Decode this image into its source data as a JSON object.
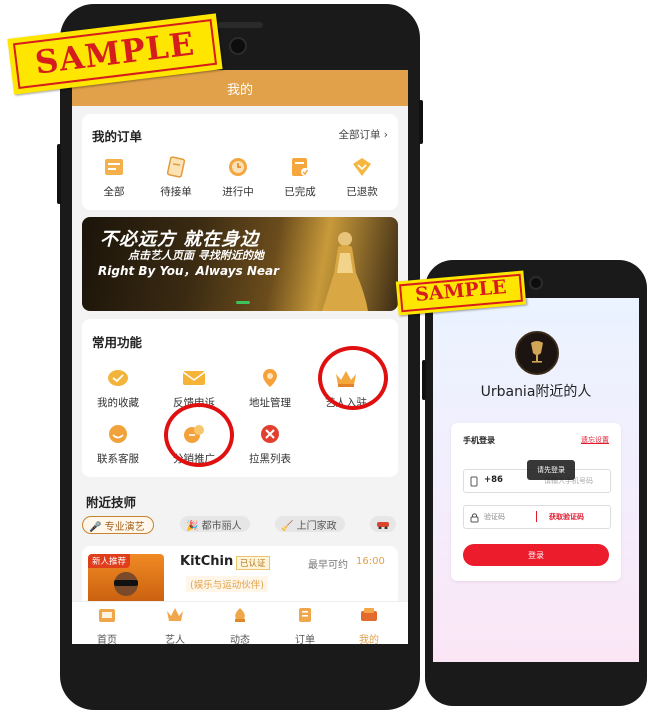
{
  "stamps": {
    "label": "SAMPLE"
  },
  "app": {
    "header_title": "我的",
    "orders": {
      "title": "我的订单",
      "all_link": "全部订单 ›",
      "items": [
        {
          "label": "全部",
          "icon": "all-orders-icon"
        },
        {
          "label": "待接单",
          "icon": "pending-order-icon"
        },
        {
          "label": "进行中",
          "icon": "in-progress-icon"
        },
        {
          "label": "已完成",
          "icon": "completed-icon"
        },
        {
          "label": "已退款",
          "icon": "refunded-icon"
        }
      ]
    },
    "banner": {
      "headline": "不必远方 就在身边",
      "subline": "点击艺人页面 寻找附近的她",
      "english": "Right By You，Always Near"
    },
    "functions": {
      "title": "常用功能",
      "items": [
        {
          "label": "我的收藏",
          "icon": "favorites-icon"
        },
        {
          "label": "反馈申诉",
          "icon": "mail-icon"
        },
        {
          "label": "地址管理",
          "icon": "address-icon"
        },
        {
          "label": "艺人入驻",
          "icon": "crown-icon"
        },
        {
          "label": "联系客服",
          "icon": "customer-service-icon"
        },
        {
          "label": "分销推广",
          "icon": "promotion-icon"
        },
        {
          "label": "拉黑列表",
          "icon": "blacklist-icon"
        }
      ]
    },
    "nearby": {
      "title": "附近技师",
      "chips": [
        "🎤 专业演艺",
        "🎉 都市丽人",
        "🧹 上门家政"
      ]
    },
    "listing": {
      "badge": "新人推荐",
      "name": "KitChin",
      "verified": "已认证",
      "availability": "最早可约",
      "time": "16:00",
      "tag": "(娱乐与运动伙伴)"
    },
    "tabbar": [
      "首页",
      "艺人",
      "动态",
      "订单",
      "我的"
    ],
    "colors": {
      "accent": "#e0a14a",
      "active_tab": "#e0a14a",
      "circle": "#e01010"
    }
  },
  "login": {
    "title": "Urbania附近的人",
    "card_title": "手机登录",
    "link": "遗忘设置",
    "country_code": "+86",
    "phone_placeholder": "请输入手机号码",
    "code_placeholder": "验证码",
    "get_code": "获取验证码",
    "tooltip": "请先登录",
    "submit": "登录",
    "colors": {
      "primary": "#ec1c2c"
    }
  }
}
